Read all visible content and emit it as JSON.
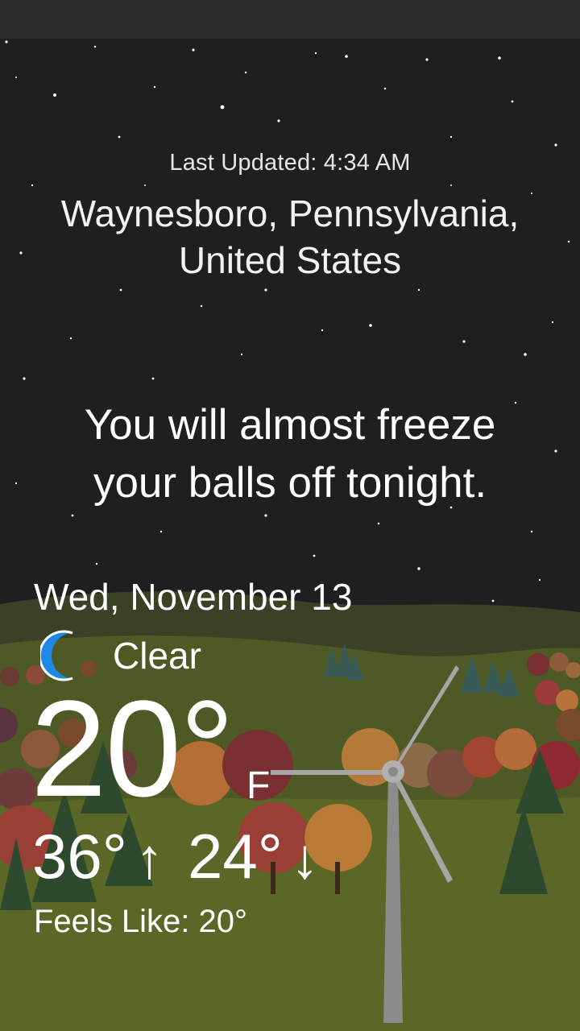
{
  "last_updated": "Last Updated: 4:34 AM",
  "location": {
    "line1": "Waynesboro, Pennsylvania,",
    "line2": "United States"
  },
  "tagline": {
    "line1": "You will almost freeze",
    "line2": "your balls off tonight."
  },
  "forecast": {
    "date": "Wed, November 13",
    "condition": "Clear",
    "condition_icon": "crescent-moon-icon",
    "temperature": "20°",
    "unit": "F",
    "high": "36°",
    "high_arrow": "↑",
    "low": "24°",
    "low_arrow": "↓",
    "feels_like": "Feels Like: 20°"
  },
  "colors": {
    "night_sky": "#1f1f21",
    "moon": "#1e88e5",
    "hills": "#4d5a25"
  }
}
